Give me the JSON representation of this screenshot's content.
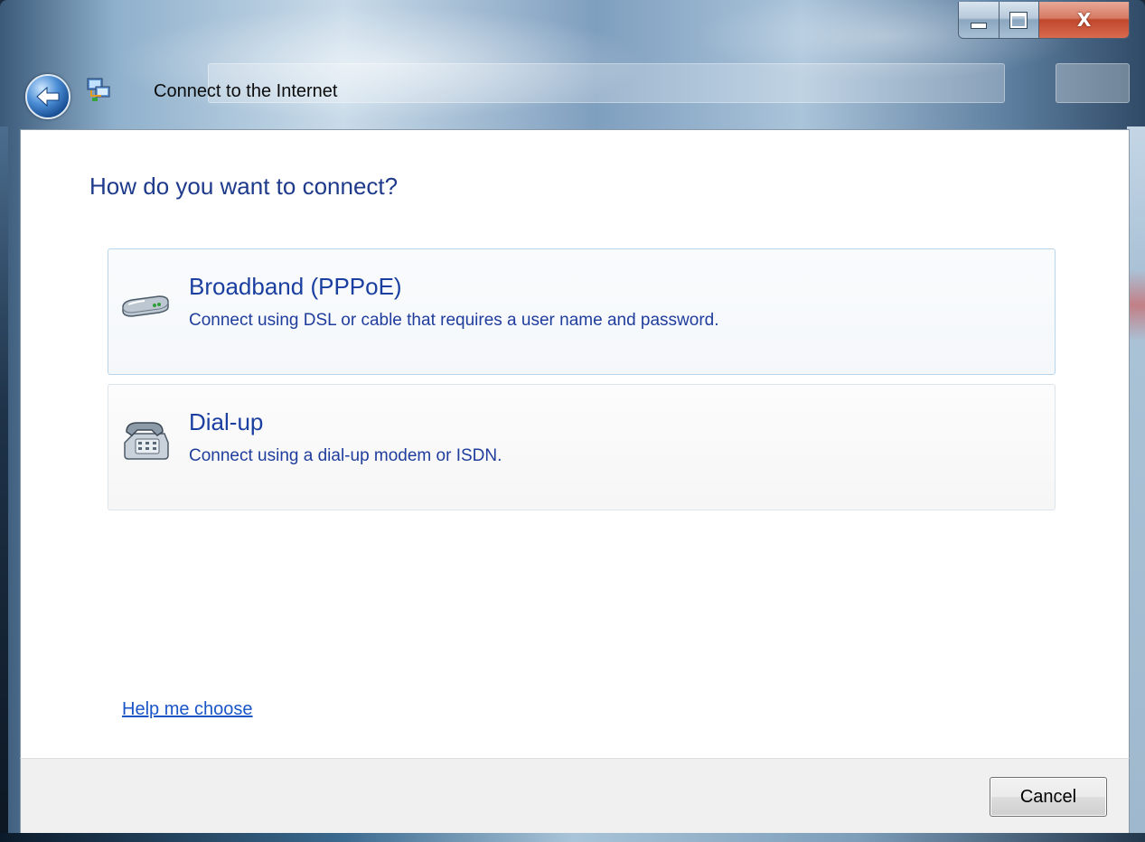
{
  "window": {
    "title": "Connect to the Internet",
    "close_glyph": "X"
  },
  "main": {
    "heading": "How do you want to connect?",
    "options": [
      {
        "title": "Broadband (PPPoE)",
        "description": "Connect using DSL or cable that requires a user name and password.",
        "icon": "broadband-modem-icon"
      },
      {
        "title": "Dial-up",
        "description": "Connect using a dial-up modem or ISDN.",
        "icon": "telephone-icon"
      }
    ],
    "help_link": "Help me choose"
  },
  "footer": {
    "cancel_label": "Cancel"
  },
  "colors": {
    "heading_blue": "#1e3a8a",
    "link_blue": "#1a55c8",
    "client_bg": "#ffffff",
    "footer_bg": "#f0f0f0"
  }
}
